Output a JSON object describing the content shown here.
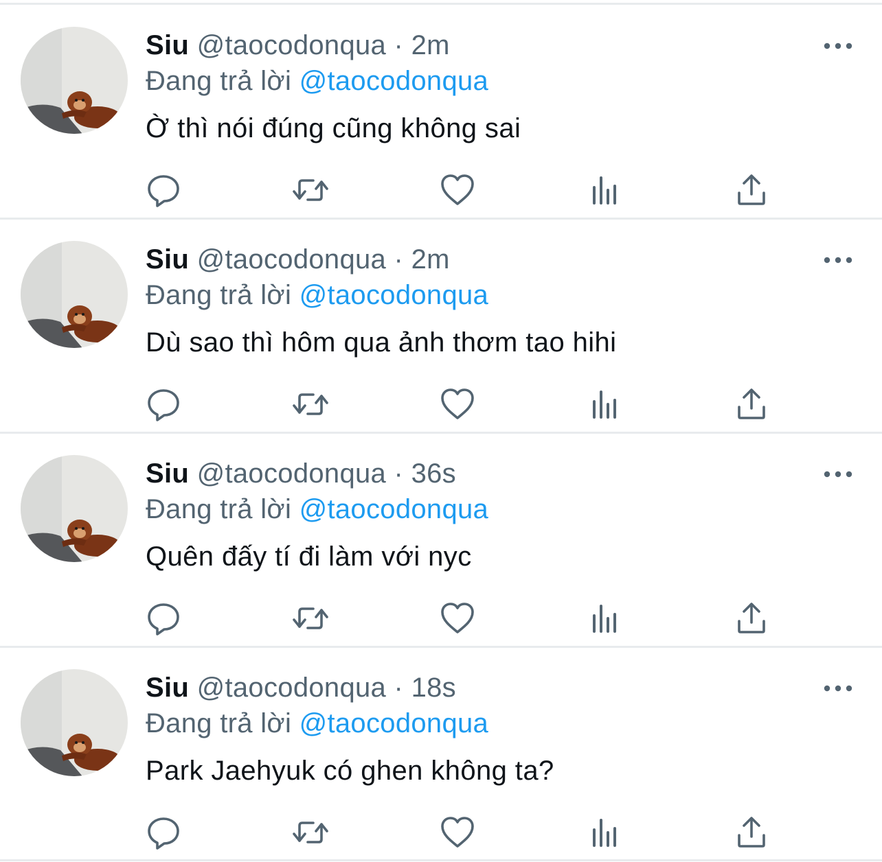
{
  "colors": {
    "text": "#0f1419",
    "secondary": "#536471",
    "accent": "#1d9bf0",
    "divider": "#e8ebed"
  },
  "icons": {
    "more": "more-horizontal-icon",
    "reply": "reply-icon",
    "retweet": "retweet-icon",
    "like": "heart-icon",
    "views": "analytics-icon",
    "share": "share-icon"
  },
  "tweets": [
    {
      "display_name": "Siu",
      "handle": "@taocodonqua",
      "separator": "·",
      "time": "2m",
      "replying_prefix": "Đang trả lời",
      "replying_to": "@taocodonqua",
      "text": "Ờ thì nói đúng cũng không sai"
    },
    {
      "display_name": "Siu",
      "handle": "@taocodonqua",
      "separator": "·",
      "time": "2m",
      "replying_prefix": "Đang trả lời",
      "replying_to": "@taocodonqua",
      "text": "Dù sao thì hôm qua ảnh thơm tao hihi"
    },
    {
      "display_name": "Siu",
      "handle": "@taocodonqua",
      "separator": "·",
      "time": "36s",
      "replying_prefix": "Đang trả lời",
      "replying_to": "@taocodonqua",
      "text": "Quên đấy tí đi làm với nyc"
    },
    {
      "display_name": "Siu",
      "handle": "@taocodonqua",
      "separator": "·",
      "time": "18s",
      "replying_prefix": "Đang trả lời",
      "replying_to": "@taocodonqua",
      "text": "Park Jaehyuk có ghen không ta?"
    }
  ]
}
